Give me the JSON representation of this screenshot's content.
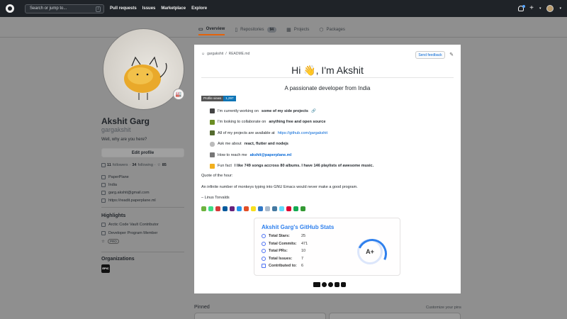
{
  "header": {
    "search_placeholder": "Search or jump to...",
    "search_key": "/",
    "nav": [
      "Pull requests",
      "Issues",
      "Marketplace",
      "Explore"
    ]
  },
  "tabs": [
    {
      "label": "Overview",
      "icon": "book-icon"
    },
    {
      "label": "Repositories",
      "count": "94",
      "icon": "repo-icon"
    },
    {
      "label": "Projects",
      "icon": "project-icon"
    },
    {
      "label": "Packages",
      "icon": "package-icon"
    }
  ],
  "profile": {
    "status_emoji": "🏭",
    "name": "Akshit Garg",
    "login": "gargakshit",
    "bio": "Well, why are you here?",
    "edit_label": "Edit profile",
    "followers_count": "11",
    "followers_label": "followers",
    "following_count": "34",
    "following_label": "following",
    "stars": "85",
    "info": [
      "PaperPlane",
      "India",
      "garg.akshit@gmail.com",
      "https://readit.paperplane.ml"
    ],
    "highlights_title": "Highlights",
    "highlights": [
      "Arctic Code Vault Contributor",
      "Developer Program Member",
      "PRO"
    ],
    "organizations_title": "Organizations",
    "org_label": "EPIC"
  },
  "readme": {
    "path_user": "gargakshit",
    "path_sep": "/",
    "path_file": "README.md",
    "feedback_label": "Send feedback",
    "hi_prefix": "Hi",
    "wave": "👋",
    "hi_suffix": ", I'm Akshit",
    "tagline": "A passionate developer from India",
    "views_label": "Profile views",
    "views_count": "1,297",
    "bullets": [
      {
        "pre": "I'm currently working on ",
        "bold": "some of my side projects",
        "post": " 🔗"
      },
      {
        "pre": "I'm looking to collaborate on ",
        "bold": "anything free and open source",
        "post": ""
      },
      {
        "pre": "All of my projects are available at ",
        "link": "https://github.com/gargakshit"
      },
      {
        "pre": "Ask me about ",
        "bold": "react, flutter and nodejs",
        "post": ""
      },
      {
        "pre": "How to reach me ",
        "link": "akshit@paperplane.ml",
        "link_bold": true
      },
      {
        "pre": "Fun fact ",
        "bold": "I like 749 songs accross 80 albums. I have 146 playlists of awesome music.",
        "post": ""
      }
    ],
    "quote_title": "Quote of the hour:",
    "quote_text": "An infinite number of monkeys typing into GNU Emacs would never make a good program.",
    "quote_author": "– Linus Torvalds",
    "tech_colors": [
      "#6db33f",
      "#3ddc84",
      "#d53a39",
      "#00599c",
      "#68217a",
      "#2496ed",
      "#e34f26",
      "#f7df1e",
      "#3178c6",
      "#a8b9cc",
      "#4479a1",
      "#61dafb",
      "#dd0031",
      "#13aa52",
      "#339933"
    ]
  },
  "stats": {
    "title": "Akshit Garg's GitHub Stats",
    "rows": [
      {
        "label": "Total Stars:",
        "value": "25"
      },
      {
        "label": "Total Commits:",
        "value": "471"
      },
      {
        "label": "Total PRs:",
        "value": "10"
      },
      {
        "label": "Total Issues:",
        "value": "7"
      },
      {
        "label": "Contributed to:",
        "value": "6"
      }
    ],
    "grade": "A+"
  },
  "pinned": {
    "title": "Pinned",
    "customize_label": "Customize your pins"
  },
  "colors": {
    "accent": "#e36209",
    "link": "#0366d6",
    "stats_blue": "#2f80ed"
  }
}
